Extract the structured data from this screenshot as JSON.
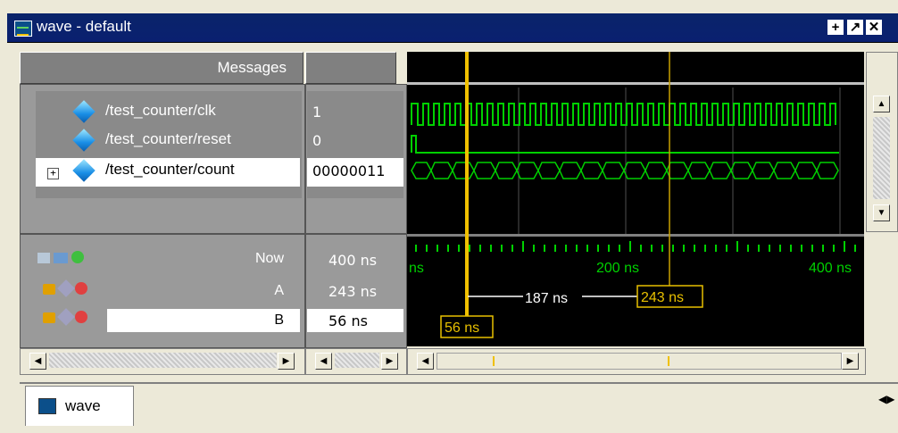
{
  "window": {
    "title": "wave - default",
    "tab_label": "wave"
  },
  "title_buttons": [
    "+",
    "↗",
    "✕"
  ],
  "headers": {
    "messages": "Messages"
  },
  "signals": [
    {
      "name": "/test_counter/clk",
      "value": "1"
    },
    {
      "name": "/test_counter/reset",
      "value": "0"
    },
    {
      "name": "/test_counter/count",
      "value": "00000011"
    }
  ],
  "cursors": [
    {
      "label": "Now",
      "value": "400 ns"
    },
    {
      "label": "A",
      "value": "243 ns"
    },
    {
      "label": "B",
      "value": "56 ns"
    }
  ],
  "timeline": {
    "ticks": [
      "ns",
      "200 ns",
      "400 ns"
    ],
    "delta_label": "187 ns",
    "cursor_a_label": "243 ns",
    "cursor_b_label": "56 ns",
    "now_ns": 400,
    "cursor_a_ns": 243,
    "cursor_b_ns": 56
  },
  "colors": {
    "wave": "#00d000",
    "cursor_active": "#f0c000",
    "cursor": "#c8a000",
    "title_bg": "#0a246a"
  }
}
